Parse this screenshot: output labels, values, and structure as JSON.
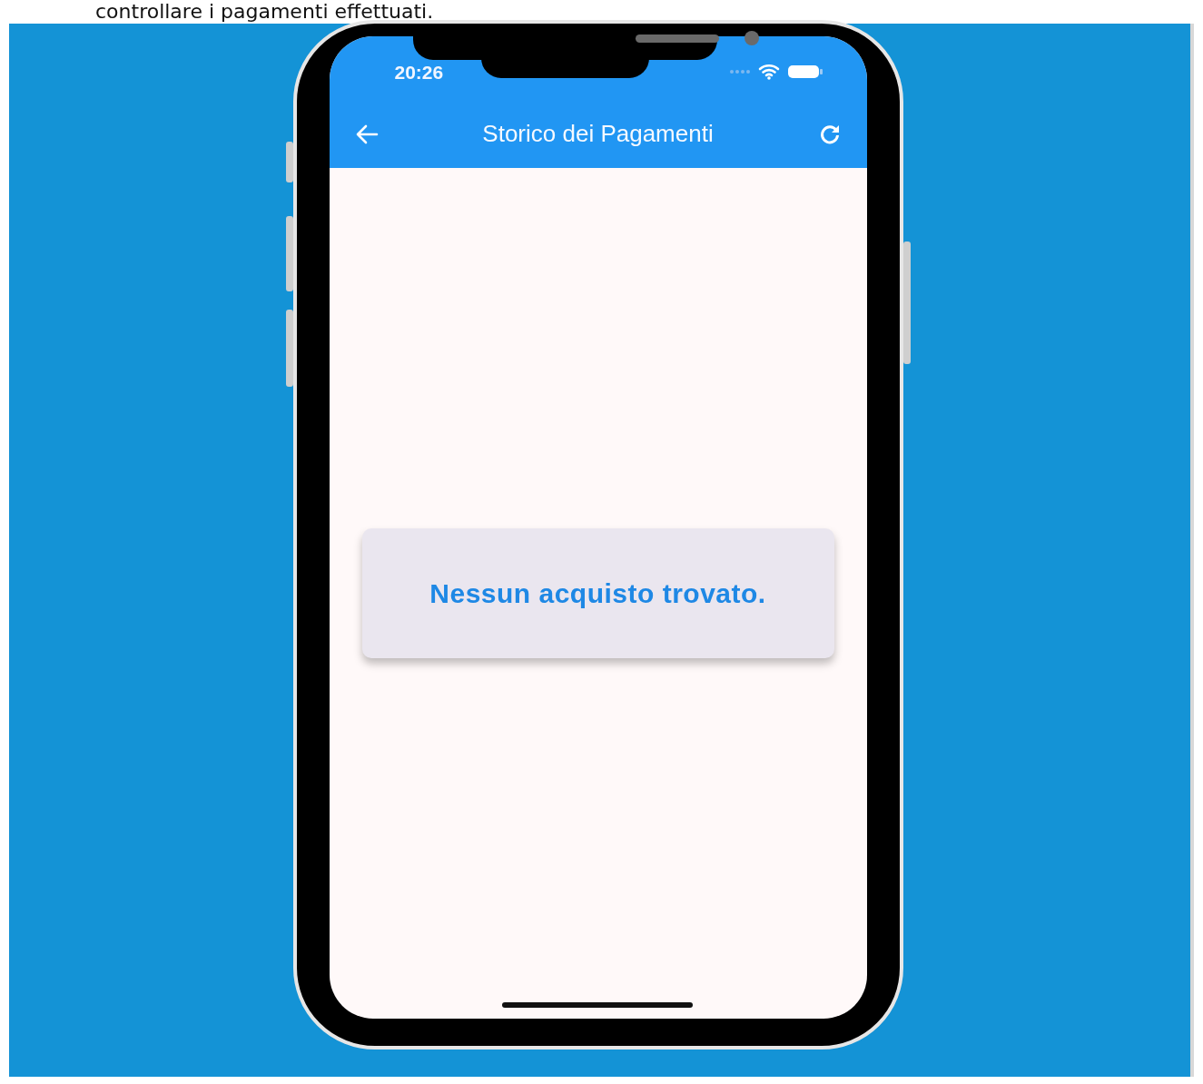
{
  "caption": "controllare i pagamenti effettuati.",
  "status_bar": {
    "time": "20:26"
  },
  "app_bar": {
    "title": "Storico dei Pagamenti"
  },
  "empty_message": "Nessun acquisto trovato."
}
